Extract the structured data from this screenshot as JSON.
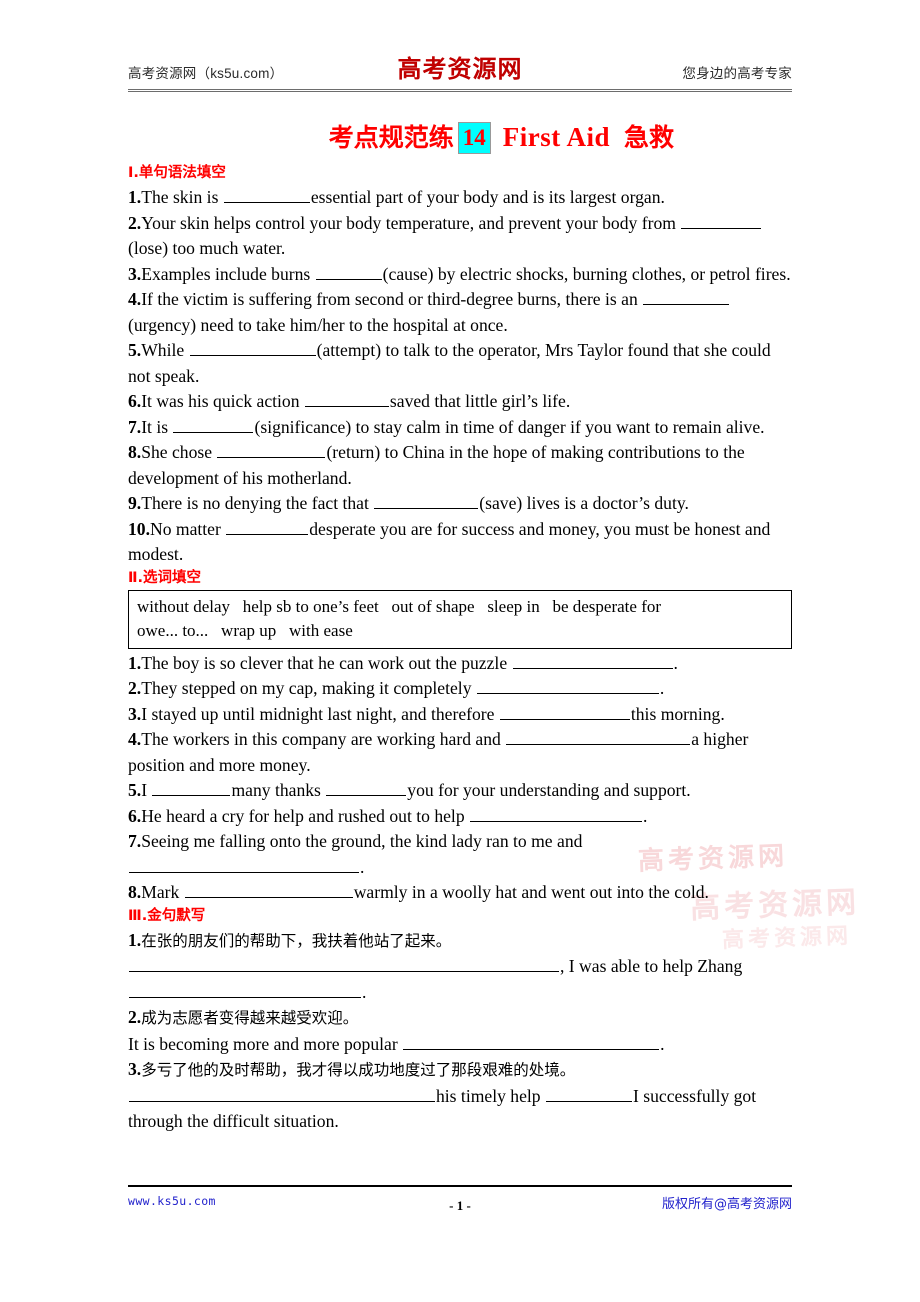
{
  "header": {
    "left_text": "高考资源网（ks5u.com）",
    "logo_text": "高考资源网",
    "right_text": "您身边的高考专家"
  },
  "title": {
    "prefix_cn": "考点规范练",
    "number": "14",
    "english": "First Aid",
    "suffix_cn": "急救",
    "number_highlight_color": "#00ffff",
    "text_color": "#ff0000"
  },
  "watermark": {
    "text": "高考资源网",
    "color": "#f3b9bd"
  },
  "sections": [
    {
      "heading": "Ⅰ.单句语法填空",
      "questions": [
        {
          "num": "1.",
          "parts": [
            "The skin is ",
            "__blank:86__",
            "essential part of your body and is its largest organ."
          ]
        },
        {
          "num": "2.",
          "parts": [
            "Your skin helps control your body temperature, and prevent your body from ",
            "__blank:80__",
            "(lose) too much water."
          ]
        },
        {
          "num": "3.",
          "parts": [
            "Examples include burns ",
            "__blank:66__",
            "(cause) by electric shocks, burning clothes, or petrol fires."
          ]
        },
        {
          "num": "4.",
          "parts": [
            "If the victim is suffering from second or third-degree burns, there is an ",
            "__blank:86__",
            "(urgency) need to take him/her to the hospital at once."
          ]
        },
        {
          "num": "5.",
          "parts": [
            "While ",
            "__blank:126__",
            "(attempt) to talk to the operator, Mrs Taylor found that she could not speak."
          ]
        },
        {
          "num": "6.",
          "parts": [
            "It was his quick action ",
            "__blank:84__",
            "saved that little girl’s life."
          ]
        },
        {
          "num": "7.",
          "parts": [
            "It is ",
            "__blank:80__",
            "(significance) to stay calm in time of danger if you want to remain alive."
          ]
        },
        {
          "num": "8.",
          "parts": [
            "She chose ",
            "__blank:108__",
            "(return) to China in the hope of making contributions to the development of his motherland."
          ]
        },
        {
          "num": "9.",
          "parts": [
            "There is no denying the fact that ",
            "__blank:104__",
            "(save) lives is a doctor’s duty."
          ]
        },
        {
          "num": "10.",
          "parts": [
            "No matter ",
            "__blank:82__",
            "desperate you are for success and money, you must be honest and modest."
          ]
        }
      ]
    },
    {
      "heading": "Ⅱ.选词填空",
      "wordbank": {
        "line1": "without delay   help sb to one’s feet   out of shape   sleep in   be desperate for",
        "line2": "owe... to...   wrap up   with ease"
      },
      "questions": [
        {
          "num": "1.",
          "parts": [
            "The boy is so clever that he can work out the puzzle ",
            "__blank:160__",
            "."
          ]
        },
        {
          "num": "2.",
          "parts": [
            "They stepped on my cap, making it completely ",
            "__blank:182__",
            "."
          ]
        },
        {
          "num": "3.",
          "parts": [
            "I stayed up until midnight last night, and therefore ",
            "__blank:130__",
            "this morning."
          ]
        },
        {
          "num": "4.",
          "parts": [
            "The workers in this company are working hard and ",
            "__blank:184__",
            "a higher position and more money."
          ]
        },
        {
          "num": "5.",
          "parts": [
            "I ",
            "__blank:78__",
            "many thanks ",
            "__blank:80__",
            "you for your understanding and support."
          ]
        },
        {
          "num": "6.",
          "parts": [
            "He heard a cry for help and rushed out to help ",
            "__blank:172__",
            "."
          ]
        },
        {
          "num": "7.",
          "parts": [
            "Seeing me falling onto the ground, the kind lady ran to me and ",
            "__blank:230__",
            "."
          ]
        },
        {
          "num": "8.",
          "parts": [
            "Mark ",
            "__blank:168__",
            "warmly in a woolly hat and went out into the cold."
          ]
        }
      ]
    },
    {
      "heading": "Ⅲ.金句默写",
      "items": [
        {
          "num": "1.",
          "cn": "在张的朋友们的帮助下，我扶着他站了起来。",
          "en_parts": [
            "__blank:430__",
            ", I was able to help Zhang ",
            "__blank:232__",
            "."
          ]
        },
        {
          "num": "2.",
          "cn": "成为志愿者变得越来越受欢迎。",
          "en_parts": [
            "It is becoming more and more popular ",
            "__blank:256__",
            "."
          ]
        },
        {
          "num": "3.",
          "cn": "多亏了他的及时帮助，我才得以成功地度过了那段艰难的处境。",
          "en_parts": [
            "__blank:306__",
            "his timely help ",
            "__blank:86__",
            "I successfully got through the difficult situation."
          ]
        }
      ]
    }
  ],
  "footer": {
    "left": "www.ks5u.com",
    "center": "- 1 -",
    "right": "版权所有@高考资源网",
    "color": "#2222cc"
  }
}
